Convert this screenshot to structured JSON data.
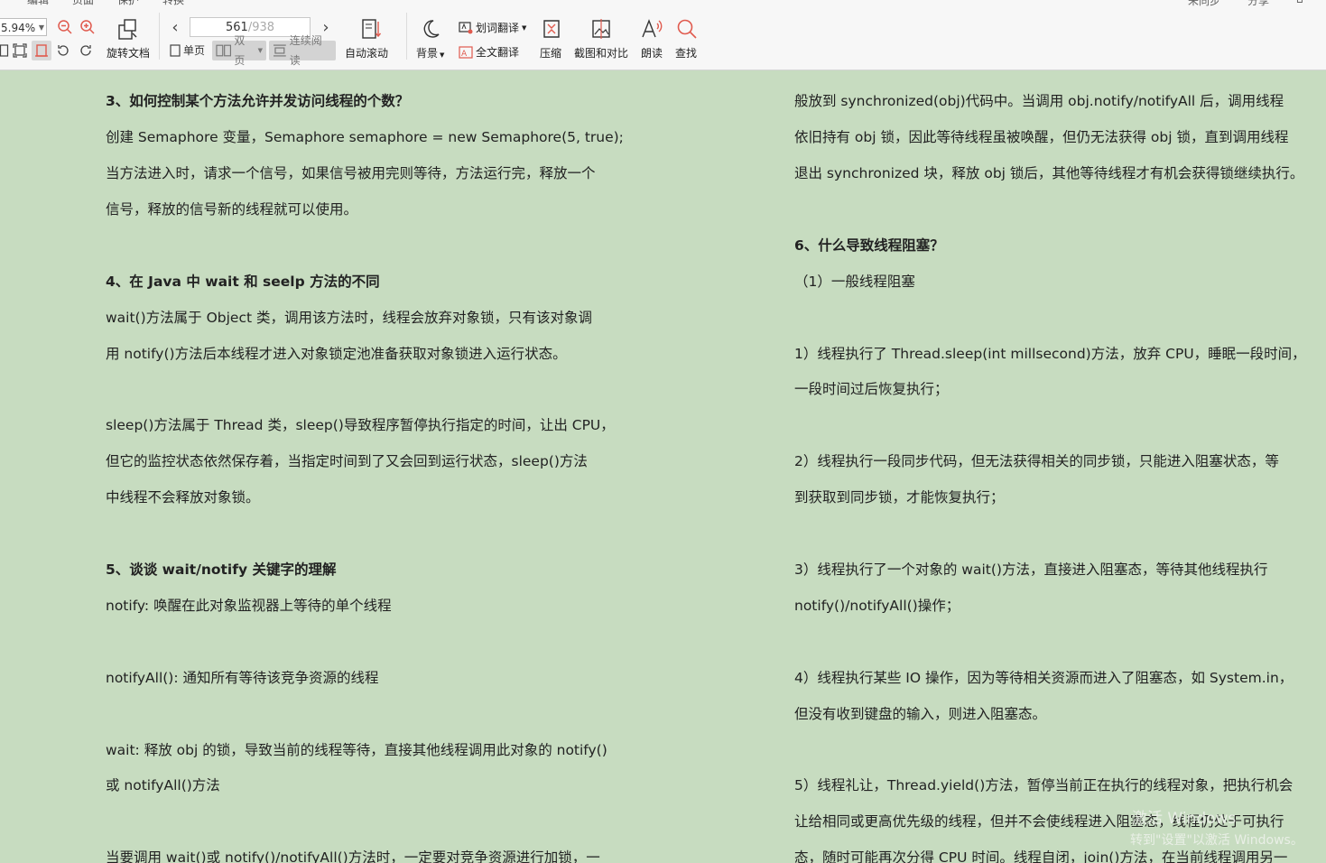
{
  "top_tabs": [
    "编辑",
    "页面",
    "保护",
    "转换"
  ],
  "top_right": [
    "未同步",
    "分享"
  ],
  "toolbar": {
    "zoom": "5.94%",
    "rotate_label": "旋转文档",
    "page_current": "561",
    "page_total": "/938",
    "single_label": "单页",
    "double_label": "双页",
    "continuous_label": "连续阅读",
    "autoscroll_label": "自动滚动",
    "background_label": "背景",
    "word_translate_label": "划词翻译",
    "full_translate_label": "全文翻译",
    "compress_label": "压缩",
    "screenshot_label": "截图和对比",
    "read_aloud_label": "朗读",
    "find_label": "查找"
  },
  "document": {
    "left_lines": [
      "3、如何控制某个方法允许并发访问线程的个数？",
      "创建 Semaphore 变量，Semaphore semaphore = new Semaphore(5, true);",
      "当方法进入时，请求一个信号，如果信号被用完则等待，方法运行完，释放一个",
      "信号，释放的信号新的线程就可以使用。",
      "4、在 Java 中 wait 和 seelp 方法的不同",
      "wait()方法属于 Object 类，调用该方法时，线程会放弃对象锁，只有该对象调",
      "用 notify()方法后本线程才进入对象锁定池准备获取对象锁进入运行状态。",
      "sleep()方法属于 Thread 类，sleep()导致程序暂停执行指定的时间，让出 CPU，",
      "但它的监控状态依然保存着，当指定时间到了又会回到运行状态，sleep()方法",
      "中线程不会释放对象锁。",
      "5、谈谈 wait/notify 关键字的理解",
      "notify:  唤醒在此对象监视器上等待的单个线程",
      "notifyAll():  通知所有等待该竞争资源的线程",
      "wait:  释放 obj 的锁，导致当前的线程等待，直接其他线程调用此对象的 notify()",
      "或 notifyAll()方法",
      "当要调用 wait()或 notify()/notifyAll()方法时，一定要对竞争资源进行加锁，一"
    ],
    "right_lines": [
      "般放到 synchronized(obj)代码中。当调用 obj.notify/notifyAll 后，调用线程",
      "依旧持有 obj 锁，因此等待线程虽被唤醒，但仍无法获得 obj 锁，直到调用线程",
      "退出 synchronized 块，释放 obj 锁后，其他等待线程才有机会获得锁继续执行。",
      "6、什么导致线程阻塞？",
      "（1）一般线程阻塞",
      "1）线程执行了 Thread.sleep(int millsecond)方法，放弃 CPU，睡眠一段时间，",
      "一段时间过后恢复执行；",
      "2）线程执行一段同步代码，但无法获得相关的同步锁，只能进入阻塞状态，等",
      "到获取到同步锁，才能恢复执行；",
      "3）线程执行了一个对象的 wait()方法，直接进入阻塞态，等待其他线程执行",
      "notify()/notifyAll()操作；",
      "4）线程执行某些 IO 操作，因为等待相关资源而进入了阻塞态，如 System.in，",
      "但没有收到键盘的输入，则进入阻塞态。",
      "5）线程礼让，Thread.yield()方法，暂停当前正在执行的线程对象，把执行机会",
      "让给相同或更高优先级的线程，但并不会使线程进入阻塞态，线程仍处于可执行",
      "态，随时可能再次分得 CPU 时间。线程自闭，join()方法，在当前线程调用另一"
    ]
  },
  "watermark": {
    "line1": "激活 Windows",
    "line2": "转到\"设置\"以激活 Windows。"
  }
}
